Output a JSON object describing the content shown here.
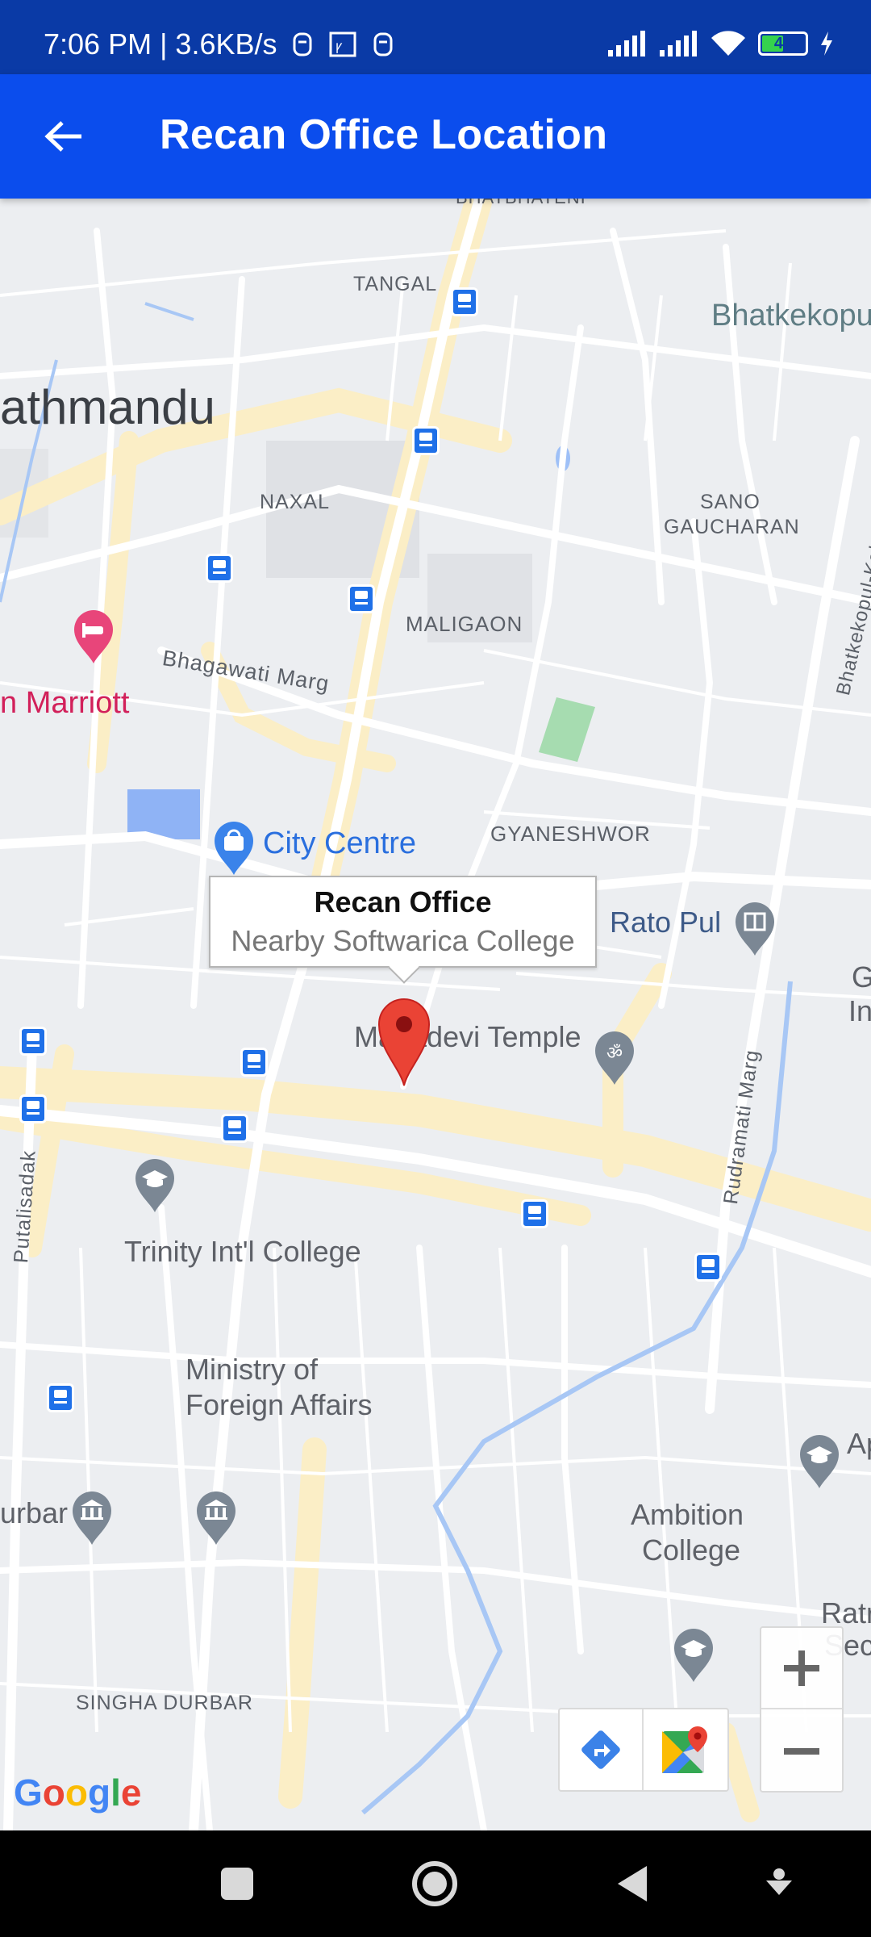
{
  "status_bar": {
    "time_speed": "7:06 PM | 3.6KB/s",
    "battery_level": "46"
  },
  "app_bar": {
    "title": "Recan Office Location"
  },
  "map": {
    "area_labels": {
      "tangal": "TANGAL",
      "naxal": "NAXAL",
      "sano_gaucharan_1": "SANO",
      "sano_gaucharan_2": "GAUCHARAN",
      "maligaon": "MALIGAON",
      "gyaneshwor": "GYANESHWOR",
      "singha_durbar": "SINGHA DURBAR",
      "bhatbhateni_partial": "BHATBHATENI"
    },
    "city_label": "athmandu",
    "place_labels": {
      "bhatkekopu": "Bhatkekopu",
      "marriott": "n Marriott",
      "city_centre": "City Centre",
      "rato_pul": "Rato Pul",
      "mahadevi_temple": "Mahadevi Temple",
      "trinity": "Trinity Int'l College",
      "ministry_1": "Ministry of",
      "ministry_2": "Foreign Affairs",
      "ambition_1": "Ambition",
      "ambition_2": "College",
      "urbar_partial": "urbar",
      "ratr_partial": "Ratr",
      "sec_partial": "Sec",
      "ap_partial": "Ap",
      "g_partial": "G",
      "in_partial": "In"
    },
    "road_labels": {
      "bhagawati_marg": "Bhagawati Marg",
      "putalisadak": "Putalisadak",
      "rudramati_marg": "Rudramati Marg",
      "bhatkekopul_kalopul": "Bhatkekopul-Kalopul"
    },
    "info_window": {
      "title": "Recan Office",
      "snippet": "Nearby Softwarica College"
    },
    "logo_text": "Google",
    "colors": {
      "marker": "#ea4335",
      "bus_stop": "#1f70e8",
      "hotel": "#e8457a",
      "poi": "#7b8794"
    }
  },
  "icons": {
    "back": "arrow-left-icon",
    "zoom_in": "plus-icon",
    "zoom_out": "minus-icon",
    "directions": "directions-icon",
    "open_maps": "google-maps-icon",
    "nav_recents": "square-icon",
    "nav_home": "circle-icon",
    "nav_back": "triangle-back-icon",
    "nav_assistant": "assistant-icon"
  }
}
